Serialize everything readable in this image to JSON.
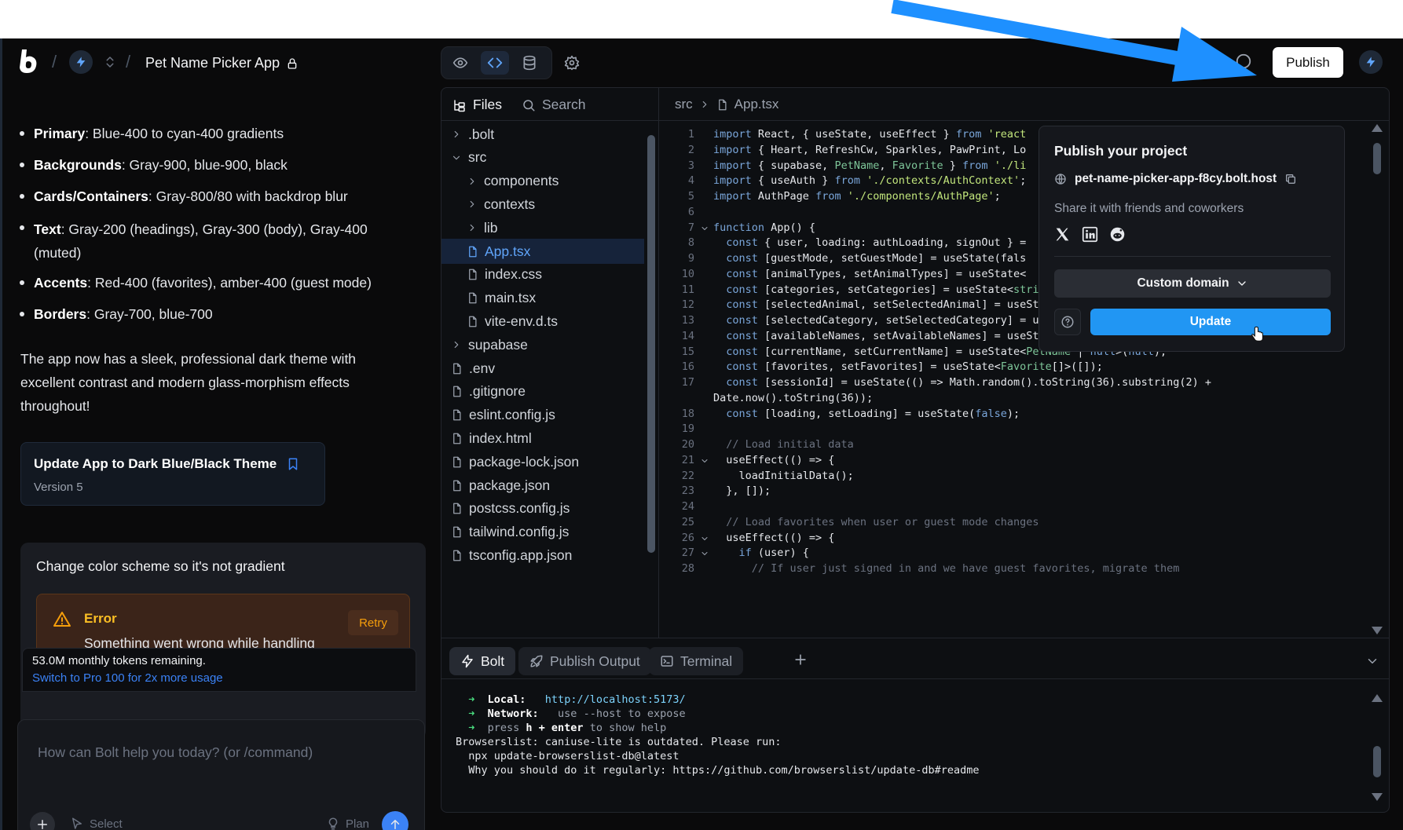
{
  "header": {
    "project_name": "Pet Name Picker App",
    "publish_label": "Publish"
  },
  "chat": {
    "bullets": [
      {
        "label": "Primary",
        "text": ": Blue-400 to cyan-400 gradients"
      },
      {
        "label": "Backgrounds",
        "text": ": Gray-900, blue-900, black"
      },
      {
        "label": "Cards/Containers",
        "text": ": Gray-800/80 with backdrop blur"
      },
      {
        "label": "Text",
        "text": ": Gray-200 (headings), Gray-300 (body), Gray-400 (muted)"
      },
      {
        "label": "Accents",
        "text": ": Red-400 (favorites), amber-400 (guest mode)"
      },
      {
        "label": "Borders",
        "text": ": Gray-700, blue-700"
      }
    ],
    "summary": "The app now has a sleek, professional dark theme with excellent contrast and modern glass-morphism effects throughout!",
    "version_card": {
      "title": "Update App to Dark Blue/Black Theme",
      "version": "Version 5"
    },
    "user_message": "Change color scheme so it's not gradient",
    "error": {
      "title": "Error",
      "message": "Something went wrong while handling your request in the background.",
      "retry_label": "Retry"
    },
    "tokens": {
      "remaining": "53.0M monthly tokens remaining.",
      "upgrade": "Switch to Pro 100 for 2x more usage"
    },
    "input": {
      "placeholder": "How can Bolt help you today? (or /command)",
      "select_label": "Select",
      "plan_label": "Plan"
    }
  },
  "workbench": {
    "files_tab": "Files",
    "search_tab": "Search",
    "breadcrumb": [
      "src",
      "App.tsx"
    ],
    "tree": [
      {
        "name": ".bolt",
        "type": "folder",
        "depth": 0
      },
      {
        "name": "src",
        "type": "folder-open",
        "depth": 0
      },
      {
        "name": "components",
        "type": "folder",
        "depth": 1
      },
      {
        "name": "contexts",
        "type": "folder",
        "depth": 1
      },
      {
        "name": "lib",
        "type": "folder",
        "depth": 1
      },
      {
        "name": "App.tsx",
        "type": "file",
        "depth": 1,
        "selected": true
      },
      {
        "name": "index.css",
        "type": "file",
        "depth": 1
      },
      {
        "name": "main.tsx",
        "type": "file",
        "depth": 1
      },
      {
        "name": "vite-env.d.ts",
        "type": "file",
        "depth": 1
      },
      {
        "name": "supabase",
        "type": "folder",
        "depth": 0
      },
      {
        "name": ".env",
        "type": "file",
        "depth": 0
      },
      {
        "name": ".gitignore",
        "type": "file",
        "depth": 0
      },
      {
        "name": "eslint.config.js",
        "type": "file",
        "depth": 0
      },
      {
        "name": "index.html",
        "type": "file",
        "depth": 0
      },
      {
        "name": "package-lock.json",
        "type": "file",
        "depth": 0
      },
      {
        "name": "package.json",
        "type": "file",
        "depth": 0
      },
      {
        "name": "postcss.config.js",
        "type": "file",
        "depth": 0
      },
      {
        "name": "tailwind.config.js",
        "type": "file",
        "depth": 0
      },
      {
        "name": "tsconfig.app.json",
        "type": "file",
        "depth": 0
      }
    ],
    "code_lines": [
      {
        "n": "1",
        "text": "import React, { useState, useEffect } from 'react"
      },
      {
        "n": "2",
        "text": "import { Heart, RefreshCw, Sparkles, PawPrint, Lo"
      },
      {
        "n": "3",
        "text": "import { supabase, PetName, Favorite } from './li"
      },
      {
        "n": "4",
        "text": "import { useAuth } from './contexts/AuthContext';"
      },
      {
        "n": "5",
        "text": "import AuthPage from './components/AuthPage';"
      },
      {
        "n": "6",
        "text": ""
      },
      {
        "n": "7",
        "text": "function App() {",
        "fold": true
      },
      {
        "n": "8",
        "text": "  const { user, loading: authLoading, signOut } = "
      },
      {
        "n": "9",
        "text": "  const [guestMode, setGuestMode] = useState(fals"
      },
      {
        "n": "10",
        "text": "  const [animalTypes, setAnimalTypes] = useState<"
      },
      {
        "n": "11",
        "text": "  const [categories, setCategories] = useState<string[]>([]);"
      },
      {
        "n": "12",
        "text": "  const [selectedAnimal, setSelectedAnimal] = useState<string>('');"
      },
      {
        "n": "13",
        "text": "  const [selectedCategory, setSelectedCategory] = useState<string>('');"
      },
      {
        "n": "14",
        "text": "  const [availableNames, setAvailableNames] = useState<PetName[]>([]);"
      },
      {
        "n": "15",
        "text": "  const [currentName, setCurrentName] = useState<PetName | null>(null);"
      },
      {
        "n": "16",
        "text": "  const [favorites, setFavorites] = useState<Favorite[]>([]);"
      },
      {
        "n": "17",
        "text": "  const [sessionId] = useState(() => Math.random().toString(36).substring(2) +"
      },
      {
        "n": "",
        "text": "Date.now().toString(36));"
      },
      {
        "n": "18",
        "text": "  const [loading, setLoading] = useState(false);"
      },
      {
        "n": "19",
        "text": ""
      },
      {
        "n": "20",
        "text": "  // Load initial data"
      },
      {
        "n": "21",
        "text": "  useEffect(() => {",
        "fold": true
      },
      {
        "n": "22",
        "text": "    loadInitialData();"
      },
      {
        "n": "23",
        "text": "  }, []);"
      },
      {
        "n": "24",
        "text": ""
      },
      {
        "n": "25",
        "text": "  // Load favorites when user or guest mode changes"
      },
      {
        "n": "26",
        "text": "  useEffect(() => {",
        "fold": true
      },
      {
        "n": "27",
        "text": "    if (user) {",
        "fold": true
      },
      {
        "n": "28",
        "text": "      // If user just signed in and we have guest favorites, migrate them"
      }
    ],
    "bottom_tabs": [
      "Bolt",
      "Publish Output",
      "Terminal"
    ],
    "terminal": [
      {
        "arrow": "➜",
        "label": "Local:",
        "value": "http://localhost:5173/"
      },
      {
        "arrow": "➜",
        "label": "Network:",
        "value": "use --host to expose"
      },
      {
        "arrow": "➜",
        "label": "press",
        "value": "h + enter",
        "suffix": "to show help"
      },
      {
        "plain": "Browserslist: caniuse-lite is outdated. Please run:"
      },
      {
        "plain": "  npx update-browserslist-db@latest"
      },
      {
        "plain": "  Why you should do it regularly: https://github.com/browserslist/update-db#readme"
      }
    ]
  },
  "publish_popover": {
    "title": "Publish your project",
    "url": "pet-name-picker-app-f8cy.bolt.host",
    "share_text": "Share it with friends and coworkers",
    "custom_domain_label": "Custom domain",
    "update_label": "Update"
  },
  "colors": {
    "accent": "#3b82f6",
    "update_button": "#2196f3",
    "error": "#f59e0b",
    "annotation_arrow": "#1e90ff"
  }
}
